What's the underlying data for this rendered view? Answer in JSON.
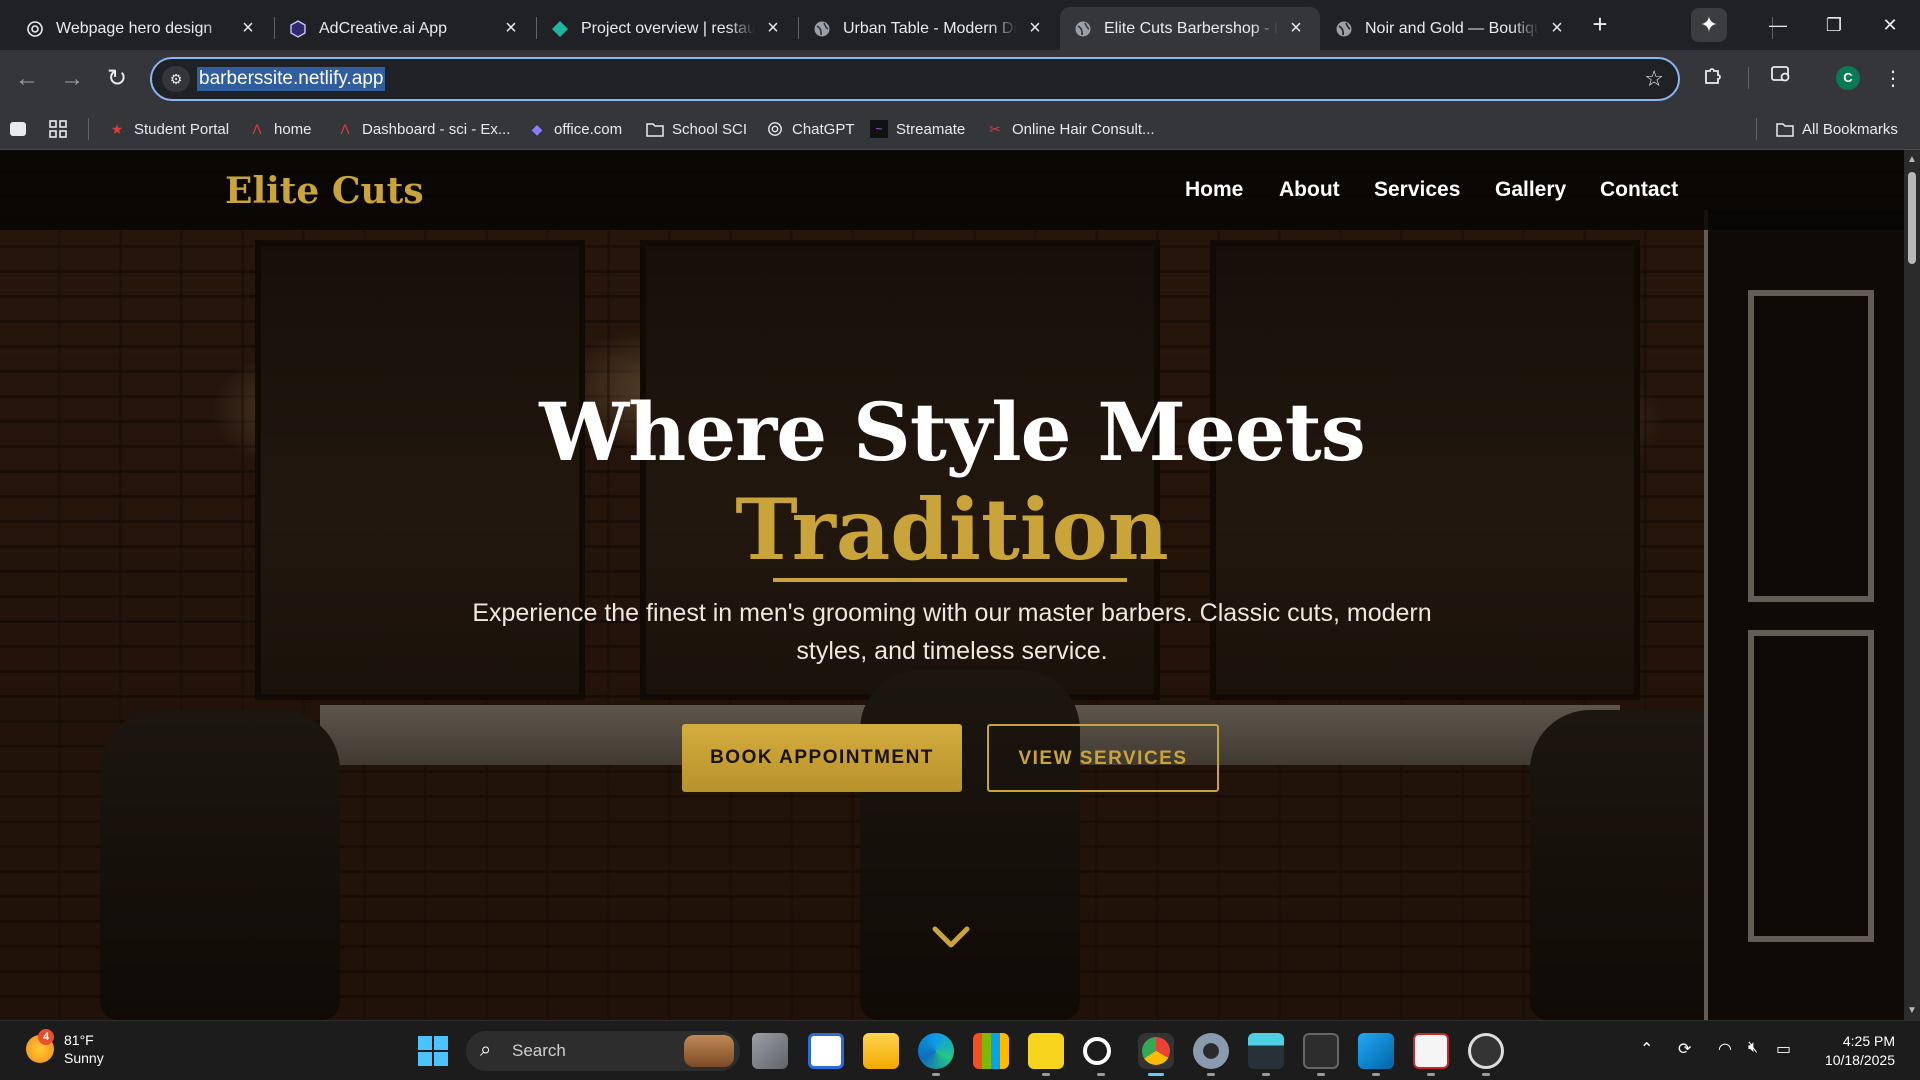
{
  "browser": {
    "tabs": [
      {
        "title": "Webpage hero design",
        "icon": "openai-icon"
      },
      {
        "title": "AdCreative.ai App",
        "icon": "hexagon-icon"
      },
      {
        "title": "Project overview | restaurant",
        "icon": "diamond-icon"
      },
      {
        "title": "Urban Table - Modern Dining",
        "icon": "globe-icon"
      },
      {
        "title": "Elite Cuts Barbershop - Premium",
        "icon": "globe-icon",
        "active": true
      },
      {
        "title": "Noir and Gold — Boutique",
        "icon": "globe-icon"
      }
    ],
    "url": "barberssite.netlify.app",
    "profile_initial": "C",
    "bookmarks": [
      {
        "label": "Student Portal",
        "icon": "star-icon"
      },
      {
        "label": "home",
        "icon": "a-logo-icon"
      },
      {
        "label": "Dashboard - sci - Ex...",
        "icon": "a-logo-icon"
      },
      {
        "label": "office.com",
        "icon": "office-icon"
      },
      {
        "label": "School SCI",
        "icon": "folder-icon"
      },
      {
        "label": "ChatGPT",
        "icon": "openai-icon"
      },
      {
        "label": "Streamate",
        "icon": "streamate-icon"
      },
      {
        "label": "Online Hair Consult...",
        "icon": "scissors-icon"
      }
    ],
    "all_bookmarks": "All Bookmarks"
  },
  "site": {
    "brand": "Elite Cuts",
    "nav": [
      "Home",
      "About",
      "Services",
      "Gallery",
      "Contact"
    ],
    "hero": {
      "title_line1": "Where Style Meets",
      "title_line2": "Tradition",
      "subtitle": "Experience the finest in men's grooming with our master barbers. Classic cuts, modern styles, and timeless service.",
      "primary_cta": "BOOK APPOINTMENT",
      "secondary_cta": "VIEW SERVICES"
    },
    "colors": {
      "gold": "#c9a43a",
      "dark": "#080604"
    }
  },
  "taskbar": {
    "weather": {
      "temp": "81°F",
      "condition": "Sunny",
      "badge": "4"
    },
    "search_placeholder": "Search",
    "time": "4:25 PM",
    "date": "10/18/2025"
  }
}
